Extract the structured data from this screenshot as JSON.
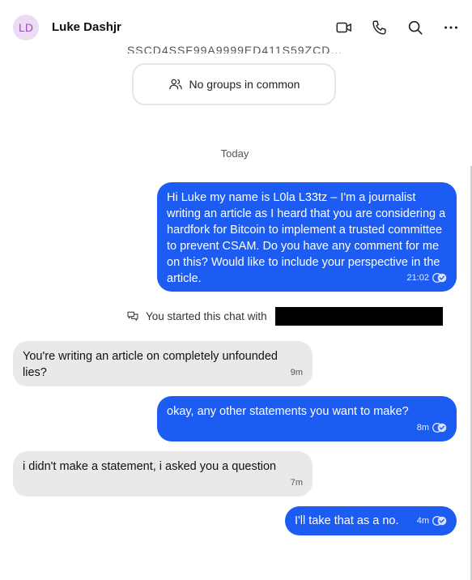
{
  "header": {
    "avatar_initials": "LD",
    "contact_name": "Luke Dashjr",
    "icons": [
      "video-call-icon",
      "phone-call-icon",
      "search-icon",
      "more-options-icon"
    ]
  },
  "conversation": {
    "cut_off_text": "SSCD4SSF99A9999ED411S59ZCD...",
    "groups_label": "No groups in common",
    "date_separator": "Today",
    "system_message": "You started this chat with",
    "messages": [
      {
        "direction": "outgoing",
        "text": "Hi Luke my name is L0la L33tz – I'm a journalist writing an article as I heard that you are considering a hardfork for Bitcoin to implement a trusted committee to prevent CSAM. Do you have any comment for me on this? Would like to include your perspective in the article.",
        "time": "21:02",
        "status": "read"
      },
      {
        "direction": "incoming",
        "text": "You're writing an article on completely unfounded lies?",
        "time": "9m"
      },
      {
        "direction": "outgoing",
        "text": "okay, any other statements you want to make?",
        "time": "8m",
        "status": "read"
      },
      {
        "direction": "incoming",
        "text": "i didn't make a statement, i asked you a question",
        "time": "7m"
      },
      {
        "direction": "outgoing",
        "text": "I'll take that as a no.",
        "time": "4m",
        "status": "read"
      }
    ]
  },
  "colors": {
    "outgoing_bubble": "#1c5cf2",
    "incoming_bubble": "#e9e9e9",
    "avatar_bg": "#ecdcf3",
    "avatar_text": "#a04bbf"
  }
}
